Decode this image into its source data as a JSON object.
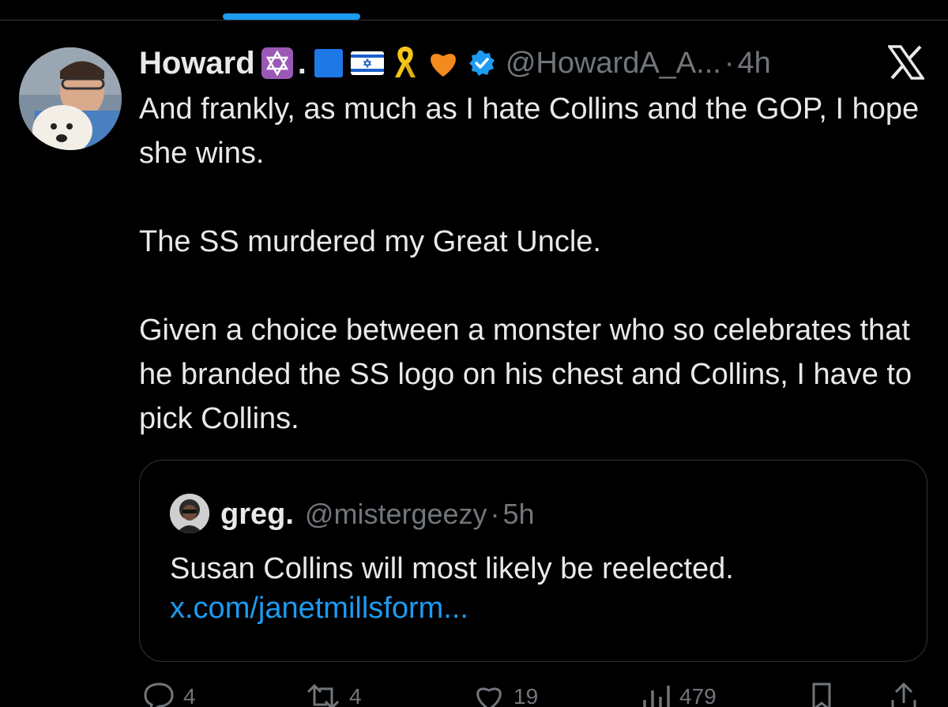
{
  "tweet": {
    "author": {
      "display_name": "Howard",
      "name_suffix": ".",
      "handle": "@HowardA_A...",
      "separator": "·",
      "time": "4h"
    },
    "paragraphs": [
      "And frankly, as much as I hate Collins and the GOP, I hope she wins.",
      "The SS murdered my Great Uncle.",
      "Given a choice between a monster who so celebrates that he branded the SS logo on his chest and Collins, I have to pick Collins."
    ],
    "quoted": {
      "display_name": "greg.",
      "handle": "@mistergeezy",
      "separator": "·",
      "time": "5h",
      "text": "Susan Collins will most likely be reelected.",
      "link": "x.com/janetmillsform..."
    },
    "actions": {
      "replies": "4",
      "reposts": "4",
      "likes": "19",
      "views": "479"
    }
  },
  "icons": {
    "name_emojis": [
      "star-of-david-icon",
      "blue-square-icon",
      "israel-flag-icon",
      "yellow-ribbon-icon",
      "orange-heart-icon",
      "verified-badge-icon"
    ],
    "brand": "x-logo-icon"
  },
  "colors": {
    "background": "#000000",
    "text": "#e7e9ea",
    "muted": "#71767b",
    "accent": "#1d9bf0",
    "border": "#2f3336"
  }
}
